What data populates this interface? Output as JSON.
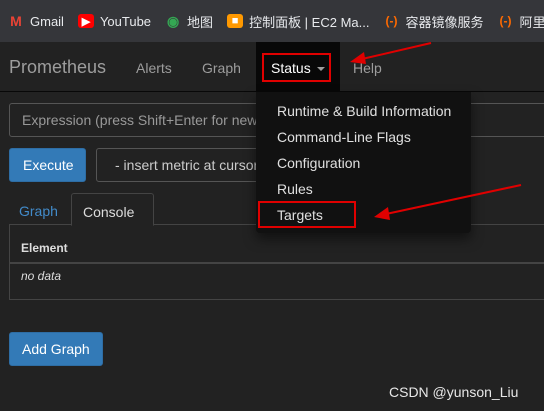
{
  "bookmarks": [
    {
      "label": "Gmail",
      "icon": "gmail-icon"
    },
    {
      "label": "YouTube",
      "icon": "youtube-icon"
    },
    {
      "label": "地图",
      "icon": "maps-icon"
    },
    {
      "label": "控制面板 | EC2 Ma...",
      "icon": "aws-ec2-icon"
    },
    {
      "label": "容器镜像服务",
      "icon": "aliyun-icon"
    },
    {
      "label": "阿里",
      "icon": "aliyun-icon"
    }
  ],
  "navbar": {
    "brand": "Prometheus",
    "alerts": "Alerts",
    "graph": "Graph",
    "status": "Status",
    "help": "Help"
  },
  "status_menu": {
    "items": [
      "Runtime & Build Information",
      "Command-Line Flags",
      "Configuration",
      "Rules",
      "Targets"
    ]
  },
  "main": {
    "expression_placeholder": "Expression (press Shift+Enter for new",
    "execute_label": "Execute",
    "metric_select": "- insert metric at cursor",
    "tabs": {
      "graph": "Graph",
      "console": "Console"
    },
    "table": {
      "header": "Element",
      "empty": "no data"
    },
    "add_graph_label": "Add Graph"
  },
  "watermark": "CSDN @yunson_Liu",
  "colors": {
    "highlight_box": "#e00000",
    "primary_button": "#337ab7",
    "link": "#428bca",
    "navbar_bg": "#222222",
    "dropdown_bg": "#111111"
  }
}
